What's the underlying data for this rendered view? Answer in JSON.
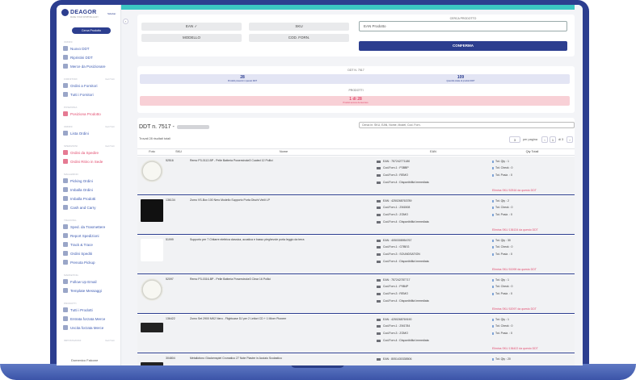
{
  "app": {
    "brand": "DEAGOR",
    "brand_sub": "MAKE YOUR SHIPPING EASY",
    "menu_label": "Sidebar"
  },
  "sidebar": {
    "button": "Cerca Prodotto",
    "sections": [
      {
        "title": "Ordini",
        "items": [
          {
            "label": "Nuovo DDT"
          },
          {
            "label": "Ripristini DDT"
          },
          {
            "label": "Merce da Posizionare"
          }
        ]
      },
      {
        "title": "Fornitori",
        "right": "Vedi Tutti",
        "items": [
          {
            "label": "Ordini a Fornitori"
          },
          {
            "label": "Tutti i Fornitori"
          }
        ]
      },
      {
        "title": "Posiziona",
        "items": [
          {
            "label": "Posiziona Prodotto"
          }
        ]
      },
      {
        "title": "Ordini",
        "right": "Vedi Tutti",
        "items": [
          {
            "label": "Lista Ordini"
          }
        ]
      },
      {
        "title": "Spedizioni",
        "right": "Vedi Tutti",
        "items": [
          {
            "label": "Ordini da Spedire"
          },
          {
            "label": "Ordini Ritiro in Sede"
          }
        ]
      },
      {
        "title": "Magazzino",
        "items": [
          {
            "label": "Picking Ordini"
          },
          {
            "label": "Imballa Ordini"
          },
          {
            "label": "Imballa Prodotti"
          },
          {
            "label": "Cash and Carry"
          }
        ]
      },
      {
        "title": "Tracking",
        "items": [
          {
            "label": "Sped. da Trasmettere"
          },
          {
            "label": "Report Spedizioni"
          },
          {
            "label": "Track & Trace"
          },
          {
            "label": "Ordini Spediti"
          },
          {
            "label": "Prenota Pickup"
          }
        ]
      },
      {
        "title": "Marketing",
        "items": [
          {
            "label": "Follow Up Email"
          },
          {
            "label": "Template Messaggi"
          }
        ]
      },
      {
        "title": "Prodotti",
        "items": [
          {
            "label": "Tutti i Prodotti"
          },
          {
            "label": "Entrata forzata Merce"
          },
          {
            "label": "Uscita forzata Merce"
          }
        ]
      },
      {
        "title": "Impostazioni",
        "right": "Vedi Tutti",
        "items": []
      }
    ],
    "user": "Domenico Falcone"
  },
  "search_panel": {
    "title": "CERCA PRODOTTO",
    "toggles": [
      "EAN ✓",
      "SKU",
      "MODELLO",
      "COD. FORN."
    ],
    "input_placeholder": "EAN Prodotto",
    "confirm": "CONFERMA"
  },
  "stats": {
    "ddt_label": "DDT N. 7517",
    "left_value": "28",
    "left_caption": "Prodotti presenti in questo DDT",
    "right_value": "109",
    "right_caption": "Quantità totale di prodotti DDT",
    "prod_label": "PRODOTTI",
    "prod_value": "1 di 28",
    "prod_caption": "Prodotti ancora da lavorare"
  },
  "list": {
    "title": "DDT n. 7517 -",
    "search_placeholder": "Cerca in: SKU, EAN, Nome, Model, Cod. Forn.",
    "found": "Trovati 28 risultati totali",
    "per_page_value": "3",
    "per_page_label": "per pagina",
    "page": "1",
    "of": "di 3",
    "prev": "‹",
    "next": "›",
    "columns": [
      "Foto",
      "SKU",
      "Nome",
      "EAN",
      "Qty Totali"
    ],
    "rows": [
      {
        "sku": "52516",
        "name": "Remo P3-0112-BP - Pelle Batteria Powerstroke3 Coated 12 Pollici",
        "ean": "EAN : 757242771180",
        "c1": "Cod.Forn.1 : P3BBP",
        "c2": "Cod.Forn.3 : REMO",
        "c4": "Cod.Forn.4 : Disponibilità Immediata",
        "tot": "Tot. Qty : 1",
        "check": "Tot. Check : 0",
        "pos": "Tot. Posiz. : 0",
        "del": "Elimina SKU 52516 da questo DDT",
        "img": "drum"
      },
      {
        "sku": "136134",
        "name": "Zomo VS-Box 100 Nero Modello Supporto Porta Dischi Vinili LP",
        "ean": "EAN : 4250268763789",
        "c1": "Cod.Forn.1 : ZM1508",
        "c2": "Cod.Forn.3 : ZOMO",
        "c4": "Cod.Forn.4 : Disponibilità Immediata",
        "tot": "Tot. Qty : 2",
        "check": "Tot. Check : 0",
        "pos": "Tot. Posiz. : 0",
        "del": "Elimina SKU 136134 da questo DDT",
        "img": "box"
      },
      {
        "sku": "51999",
        "name": "Supporto per 7 Chitarre elettrica classica, acustica e basso pieghevole porta leggio da terra",
        "ean": "EAN : 4050308954767",
        "c1": "Cod.Forn.1 : G7BEG",
        "c2": "Cod.Forn.3 : SOUNDSATION",
        "c4": "Cod.Forn.4 : Disponibilità Immediata",
        "tot": "Tot. Qty : 30",
        "check": "Tot. Check : 0",
        "pos": "Tot. Posiz. : 0",
        "del": "Elimina SKU 51999 da questo DDT",
        "img": "stand"
      },
      {
        "sku": "52097",
        "name": "Remo P3-0316-BP - Pelle Batteria Powerstroke3 Clear 16 Pollici",
        "ean": "EAN : 757242787717",
        "c1": "Cod.Forn.1 : P9B4P",
        "c2": "Cod.Forn.3 : REMO",
        "c4": "Cod.Forn.4 : Disponibilità Immediata",
        "tot": "Tot. Qty : 1",
        "check": "Tot. Check : 0",
        "pos": "Tot. Posiz. : 0",
        "del": "Elimina SKU 52097 da questo DDT",
        "img": "drum"
      },
      {
        "sku": "136422",
        "name": "Zomo Set 2900 MK2 Nero - Flightcase DJ per 2 Lettori CD + 1 Mixer Pioneer",
        "ean": "EAN : 4250268769190",
        "c1": "Cod.Forn.1 : ZM1784",
        "c2": "Cod.Forn.3 : ZOMO",
        "c4": "Cod.Forn.4 : Disponibilità Immediata",
        "tot": "Tot. Qty : 1",
        "check": "Tot. Check : 0",
        "pos": "Tot. Posiz. : 0",
        "del": "Elimina SKU 136422 da questo DDT",
        "img": "keyb"
      },
      {
        "sku": "304804",
        "name": "Metallofono Glockenspiel Cromatico 27 Note Piastre in Acciaio Scolastico",
        "ean": "EAN : 8051430338506",
        "tot": "Tot. Qty : 20",
        "img": "keyb"
      }
    ]
  }
}
